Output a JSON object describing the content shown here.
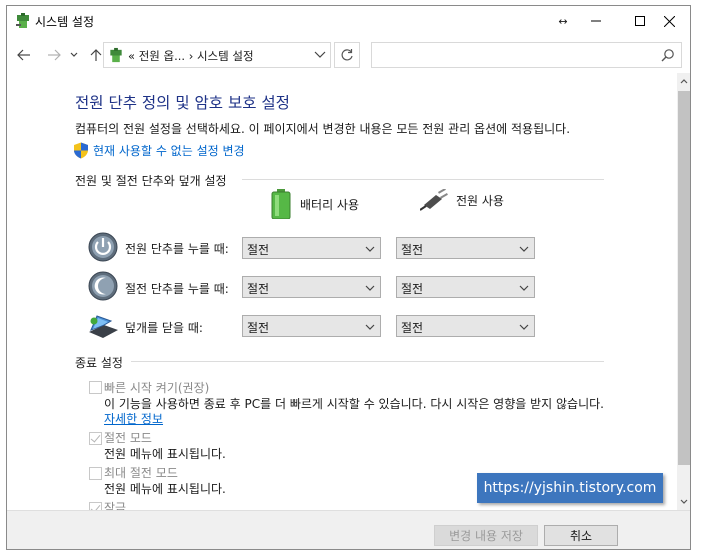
{
  "window": {
    "title": "시스템 설정",
    "resize_glyph": "↔"
  },
  "address": {
    "path": "« 전원 옵... › 시스템 설정",
    "search_placeholder": ""
  },
  "page": {
    "title": "전원 단추 정의 및 암호 보호 설정",
    "description": "컴퓨터의 전원 설정을 선택하세요. 이 페이지에서 변경한 내용은 모든 전원 관리 옵션에 적용됩니다.",
    "change_link": "현재 사용할 수 없는 설정 변경"
  },
  "power_section": {
    "heading": "전원 및 절전 단추와 덮개 설정",
    "columns": [
      "배터리 사용",
      "전원 사용"
    ],
    "rows": [
      {
        "label": "전원 단추를 누를 때:",
        "battery": "절전",
        "plugged": "절전"
      },
      {
        "label": "절전 단추를 누를 때:",
        "battery": "절전",
        "plugged": "절전"
      },
      {
        "label": "덮개를 닫을 때:",
        "battery": "절전",
        "plugged": "절전"
      }
    ]
  },
  "shutdown_section": {
    "heading": "종료 설정",
    "items": [
      {
        "label": "빠른 시작 켜기(권장)",
        "checked": false,
        "description": "이 기능을 사용하면 종료 후 PC를 더 빠르게 시작할 수 있습니다. 다시 시작은 영향을 받지 않습니다.",
        "link": "자세한 정보"
      },
      {
        "label": "절전 모드",
        "checked": true,
        "description": "전원 메뉴에 표시됩니다."
      },
      {
        "label": "최대 절전 모드",
        "checked": false,
        "description": "전원 메뉴에 표시됩니다."
      },
      {
        "label": "잠금",
        "checked": true
      }
    ]
  },
  "footer": {
    "save_label": "변경 내용 저장",
    "cancel_label": "취소"
  },
  "watermark": "https://yjshin.tistory.com",
  "colors": {
    "title_blue": "#1e3287",
    "link_blue": "#0066cc",
    "watermark_bg": "#3d76be"
  }
}
